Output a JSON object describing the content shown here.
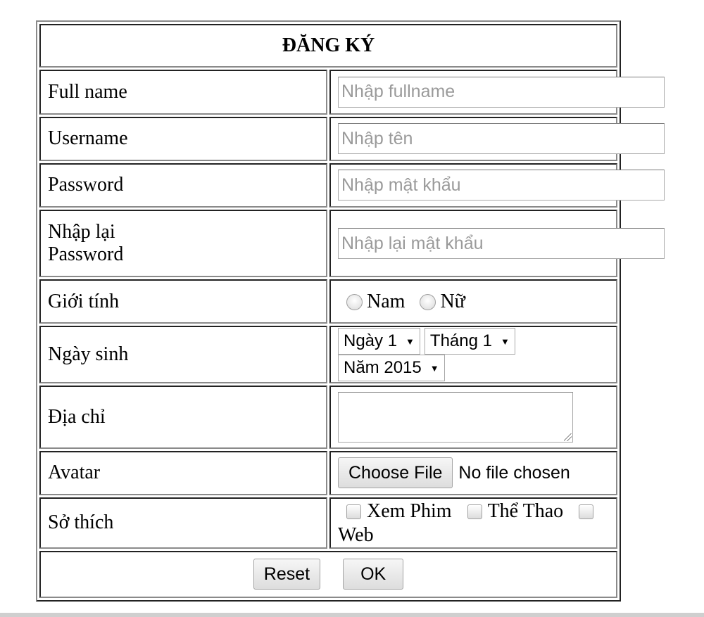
{
  "form": {
    "title": "ĐĂNG KÝ",
    "fullname": {
      "label": "Full name",
      "placeholder": "Nhập fullname",
      "value": ""
    },
    "username": {
      "label": "Username",
      "placeholder": "Nhập tên",
      "value": ""
    },
    "password": {
      "label": "Password",
      "placeholder": "Nhập mật khẩu",
      "value": ""
    },
    "confirm_password": {
      "label_line1": "Nhập lại",
      "label_line2": "Password",
      "placeholder": "Nhập lại mật khẩu",
      "value": ""
    },
    "gender": {
      "label": "Giới tính",
      "options": [
        "Nam",
        "Nữ"
      ],
      "selected": null
    },
    "birthday": {
      "label": "Ngày sinh",
      "day": "Ngày 1",
      "month": "Tháng 1",
      "year": "Năm 2015"
    },
    "address": {
      "label": "Địa chỉ",
      "value": ""
    },
    "avatar": {
      "label": "Avatar",
      "button": "Choose File",
      "status": "No file chosen"
    },
    "hobbies": {
      "label": "Sở thích",
      "options": [
        "Xem Phim",
        "Thể Thao",
        "Web"
      ],
      "checked": [
        false,
        false,
        false
      ]
    },
    "actions": {
      "reset": "Reset",
      "ok": "OK"
    }
  }
}
